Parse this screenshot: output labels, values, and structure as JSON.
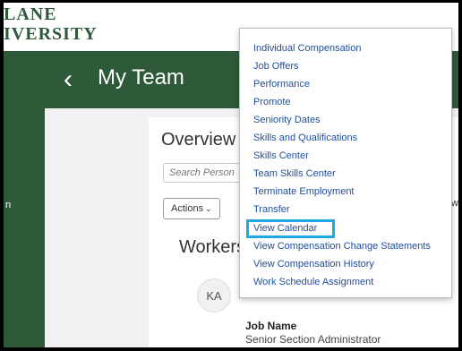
{
  "logo": {
    "line1": "LANE",
    "line2": "IVERSITY"
  },
  "header": {
    "back_glyph": "‹",
    "title": "My Team"
  },
  "overview": {
    "title": "Overview",
    "search_placeholder": "Search Person",
    "actions_label": "Actions",
    "actions_chevron": "⌄",
    "workers_title": "Workers"
  },
  "worker": {
    "initials": "KA",
    "job_label": "Job Name",
    "job_value": "Senior Section Administrator"
  },
  "edge_text": {
    "right": "w",
    "left": "n"
  },
  "menu": {
    "items": [
      "Individual Compensation",
      "Job Offers",
      "Performance",
      "Promote",
      "Seniority Dates",
      "Skills and Qualifications",
      "Skills Center",
      "Team Skills Center",
      "Terminate Employment",
      "Transfer",
      "View Calendar",
      "View Compensation Change Statements",
      "View Compensation History",
      "Work Schedule Assignment"
    ],
    "highlighted_item": "View Calendar"
  },
  "colors": {
    "brand_green": "#2f5a3a",
    "menu_link": "#1f4e9c",
    "highlight_border": "#1ea8e6"
  }
}
